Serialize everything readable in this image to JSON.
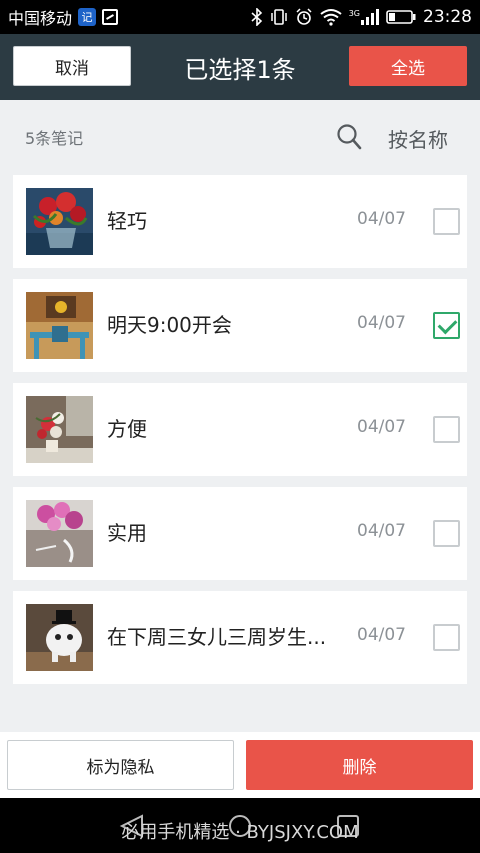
{
  "status_bar": {
    "carrier": "中国移动",
    "badge": "记",
    "network": "3G",
    "time": "23:28"
  },
  "header": {
    "cancel_label": "取消",
    "title": "已选择1条",
    "select_all_label": "全选",
    "colors": {
      "background": "#2c3b43",
      "accent": "#e95449"
    }
  },
  "subheader": {
    "count_text": "5条笔记",
    "sort_label": "按名称",
    "search_icon": "search-icon"
  },
  "notes": [
    {
      "title": "轻巧",
      "date": "04/07",
      "checked": false,
      "thumb_icon": "red-flowers-image"
    },
    {
      "title": "明天9:00开会",
      "date": "04/07",
      "checked": true,
      "thumb_icon": "cafe-table-image"
    },
    {
      "title": "方便",
      "date": "04/07",
      "checked": false,
      "thumb_icon": "flower-vase-image"
    },
    {
      "title": "实用",
      "date": "04/07",
      "checked": false,
      "thumb_icon": "pink-flowers-image"
    },
    {
      "title": "在下周三女儿三周岁生...",
      "date": "04/07",
      "checked": false,
      "thumb_icon": "toy-figure-image"
    }
  ],
  "bottom_bar": {
    "mark_private_label": "标为隐私",
    "delete_label": "删除"
  },
  "nav_bar": {
    "watermark": "必用手机精选 · BYJSJXY.COM",
    "icons": [
      "back-icon",
      "home-icon",
      "recent-apps-icon"
    ]
  }
}
